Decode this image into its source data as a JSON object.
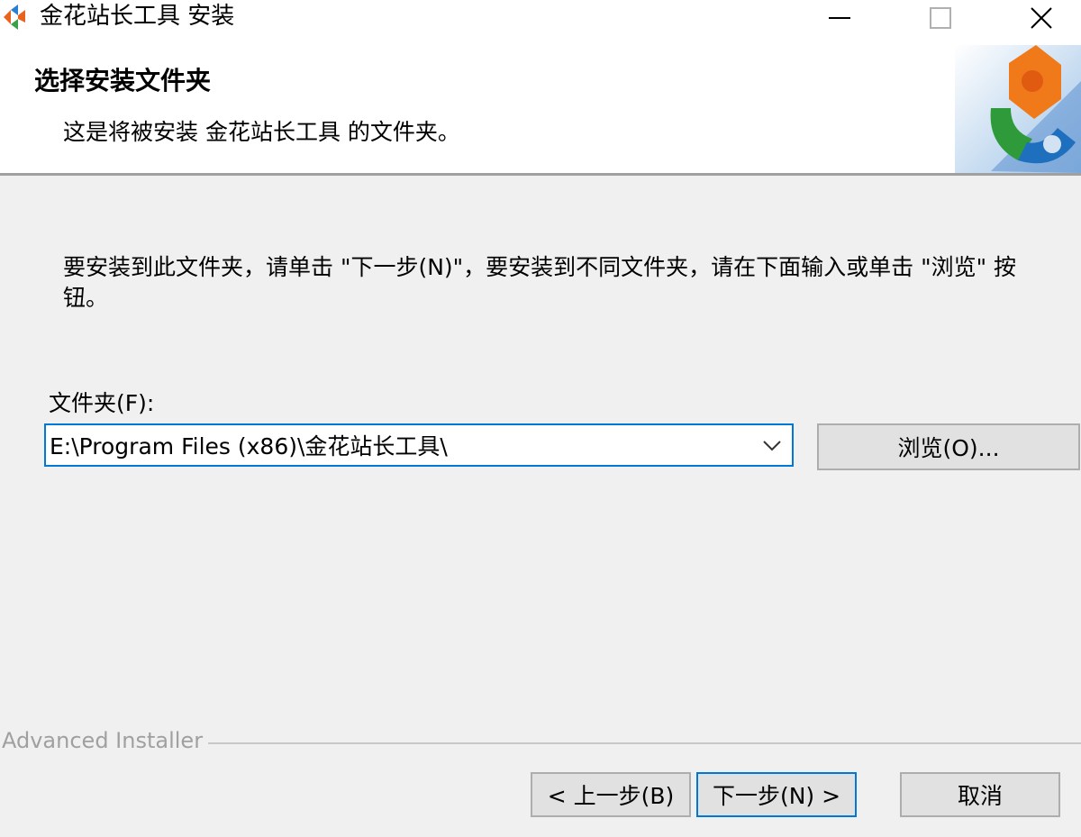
{
  "window": {
    "title": "金花站长工具 安装",
    "app_icon": "installer-puzzle-icon",
    "controls": {
      "minimize": "minimize-icon",
      "maximize": "maximize-icon",
      "close": "close-icon"
    }
  },
  "header": {
    "title": "选择安装文件夹",
    "subtitle": "这是将被安装 金花站长工具 的文件夹。",
    "logo_icon": "puzzle-logo-icon"
  },
  "body": {
    "instructions": "要安装到此文件夹，请单击 \"下一步(N)\"，要安装到不同文件夹，请在下面输入或单击 \"浏览\" 按钮。",
    "folder_label": "文件夹(F):",
    "folder_value": "E:\\Program Files (x86)\\金花站长工具\\",
    "browse_label": "浏览(O)..."
  },
  "footer": {
    "brand": "Advanced Installer",
    "back_label": "< 上一步(B)",
    "next_label": "下一步(N) >",
    "cancel_label": "取消"
  },
  "colors": {
    "accent": "#0078d7",
    "window_bg": "#f0f0f0",
    "header_bg": "#ffffff",
    "button_bg": "#e1e1e1"
  }
}
